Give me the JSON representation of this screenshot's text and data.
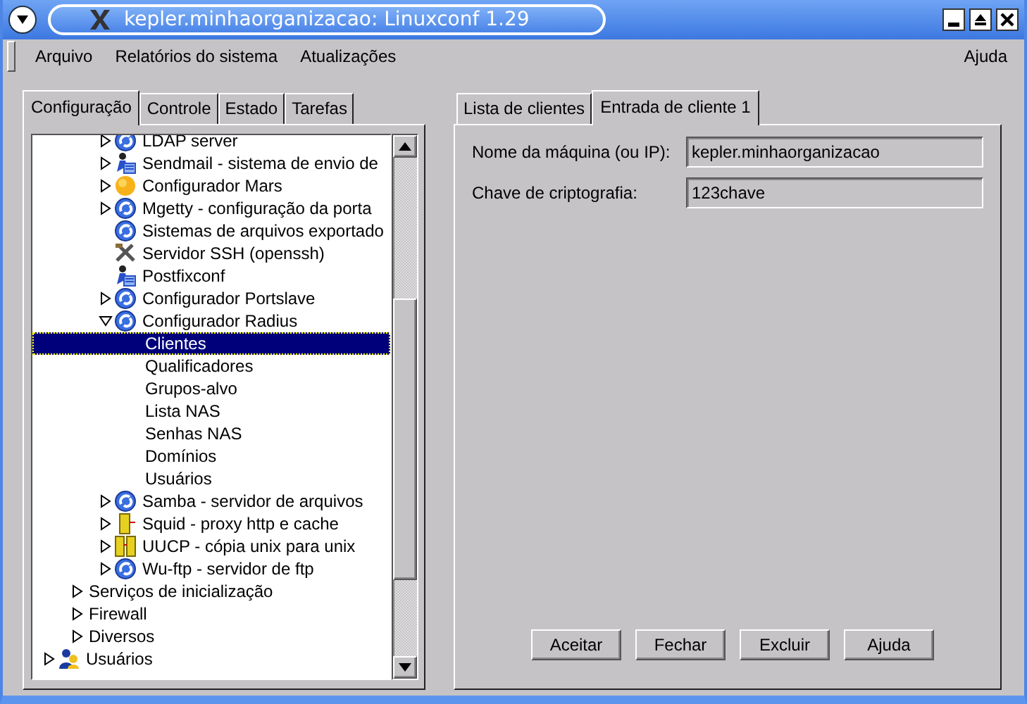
{
  "window": {
    "title": "kepler.minhaorganizacao: Linuxconf 1.29"
  },
  "menu": {
    "items": [
      "Arquivo",
      "Relatórios do sistema",
      "Atualizações"
    ],
    "help": "Ajuda"
  },
  "left_tabs": [
    {
      "label": "Configuração",
      "selected": true
    },
    {
      "label": "Controle",
      "selected": false
    },
    {
      "label": "Estado",
      "selected": false
    },
    {
      "label": "Tarefas",
      "selected": false
    }
  ],
  "tree": [
    {
      "children": [
        {
          "children": [
            {
              "label": "LDAP server",
              "kind": "gear",
              "expanded": false,
              "selected": false
            },
            {
              "label": "Sendmail - sistema de envio de",
              "kind": "mail",
              "expanded": false,
              "selected": false
            },
            {
              "label": "Configurador Mars",
              "kind": "sun",
              "expanded": false,
              "selected": false
            },
            {
              "label": "Mgetty - configuração da porta",
              "kind": "gear",
              "expanded": false,
              "selected": false
            },
            {
              "label": "Sistemas de arquivos exportado",
              "kind": "gear",
              "selected": false
            },
            {
              "label": "Servidor SSH (openssh)",
              "kind": "tools",
              "selected": false
            },
            {
              "label": "Postfixconf",
              "kind": "mail",
              "selected": false
            },
            {
              "label": "Configurador Portslave",
              "kind": "gear",
              "expanded": false,
              "selected": false
            },
            {
              "label": "Configurador Radius",
              "kind": "gear",
              "expanded": true,
              "selected": false,
              "children": [
                {
                  "label": "Clientes",
                  "selected": true
                },
                {
                  "label": "Qualificadores",
                  "selected": false
                },
                {
                  "label": "Grupos-alvo",
                  "selected": false
                },
                {
                  "label": "Lista NAS",
                  "selected": false
                },
                {
                  "label": "Senhas NAS",
                  "selected": false
                },
                {
                  "label": "Domínios",
                  "selected": false
                },
                {
                  "label": "Usuários",
                  "selected": false
                }
              ]
            },
            {
              "label": "Samba - servidor de arquivos",
              "kind": "gear",
              "expanded": false,
              "selected": false
            },
            {
              "label": "Squid - proxy http e cache",
              "kind": "server",
              "expanded": false,
              "selected": false
            },
            {
              "label": "UUCP - cópia unix para unix",
              "kind": "servers",
              "expanded": false,
              "selected": false
            },
            {
              "label": "Wu-ftp - servidor de ftp",
              "kind": "gear",
              "expanded": false,
              "selected": false
            }
          ]
        },
        {
          "label": "Serviços de inicialização",
          "expanded": false,
          "selected": false
        },
        {
          "label": "Firewall",
          "expanded": false,
          "selected": false
        },
        {
          "label": "Diversos",
          "expanded": false,
          "selected": false
        }
      ]
    },
    {
      "label": "Usuários",
      "kind": "users",
      "expanded": false,
      "selected": false
    }
  ],
  "right_tabs": [
    {
      "label": "Lista de clientes",
      "selected": false
    },
    {
      "label": "Entrada de cliente 1",
      "selected": true
    }
  ],
  "fields": [
    {
      "label": "Nome da máquina (ou IP):",
      "value": "kepler.minhaorganizacao"
    },
    {
      "label": "Chave de criptografia:",
      "value": "123chave"
    }
  ],
  "buttons": [
    "Aceitar",
    "Fechar",
    "Excluir",
    "Ajuda"
  ]
}
